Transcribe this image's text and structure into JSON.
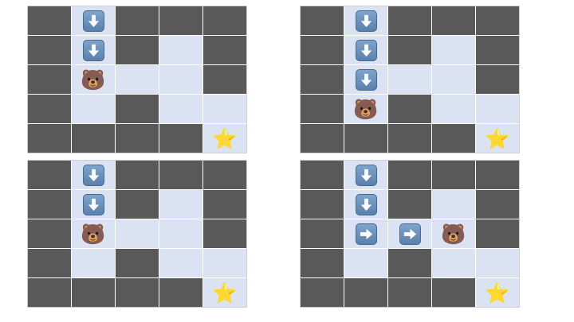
{
  "glyphs": {
    "bear": "🐻",
    "star": "⭐"
  },
  "legend": {
    "wall": "wall",
    "open": "open",
    "bear": "bear",
    "star": "star",
    "arrow_down": "arrow-down",
    "arrow_right": "arrow-right"
  },
  "colors": {
    "wall": "#595959",
    "open": "#dbe3f3",
    "arrow_tile": "#6f93bd"
  },
  "panels": [
    {
      "name": "panel-top-left",
      "grid": [
        [
          "wall",
          "arrow_down",
          "wall",
          "wall",
          "wall"
        ],
        [
          "wall",
          "arrow_down",
          "wall",
          "open",
          "wall"
        ],
        [
          "wall",
          "bear",
          "open",
          "open",
          "wall"
        ],
        [
          "wall",
          "open",
          "wall",
          "open",
          "open"
        ],
        [
          "wall",
          "wall",
          "wall",
          "wall",
          "star"
        ]
      ]
    },
    {
      "name": "panel-top-right",
      "grid": [
        [
          "wall",
          "arrow_down",
          "wall",
          "wall",
          "wall"
        ],
        [
          "wall",
          "arrow_down",
          "wall",
          "open",
          "wall"
        ],
        [
          "wall",
          "arrow_down",
          "open",
          "open",
          "wall"
        ],
        [
          "wall",
          "bear",
          "wall",
          "open",
          "open"
        ],
        [
          "wall",
          "wall",
          "wall",
          "wall",
          "star"
        ]
      ]
    },
    {
      "name": "panel-bottom-left",
      "grid": [
        [
          "wall",
          "arrow_down",
          "wall",
          "wall",
          "wall"
        ],
        [
          "wall",
          "arrow_down",
          "wall",
          "open",
          "wall"
        ],
        [
          "wall",
          "bear",
          "open",
          "open",
          "wall"
        ],
        [
          "wall",
          "open",
          "wall",
          "open",
          "open"
        ],
        [
          "wall",
          "wall",
          "wall",
          "wall",
          "star"
        ]
      ]
    },
    {
      "name": "panel-bottom-right",
      "grid": [
        [
          "wall",
          "arrow_down",
          "wall",
          "wall",
          "wall"
        ],
        [
          "wall",
          "arrow_down",
          "wall",
          "open",
          "wall"
        ],
        [
          "wall",
          "arrow_right",
          "arrow_right",
          "bear",
          "wall"
        ],
        [
          "wall",
          "open",
          "wall",
          "open",
          "open"
        ],
        [
          "wall",
          "wall",
          "wall",
          "wall",
          "star"
        ]
      ]
    }
  ]
}
